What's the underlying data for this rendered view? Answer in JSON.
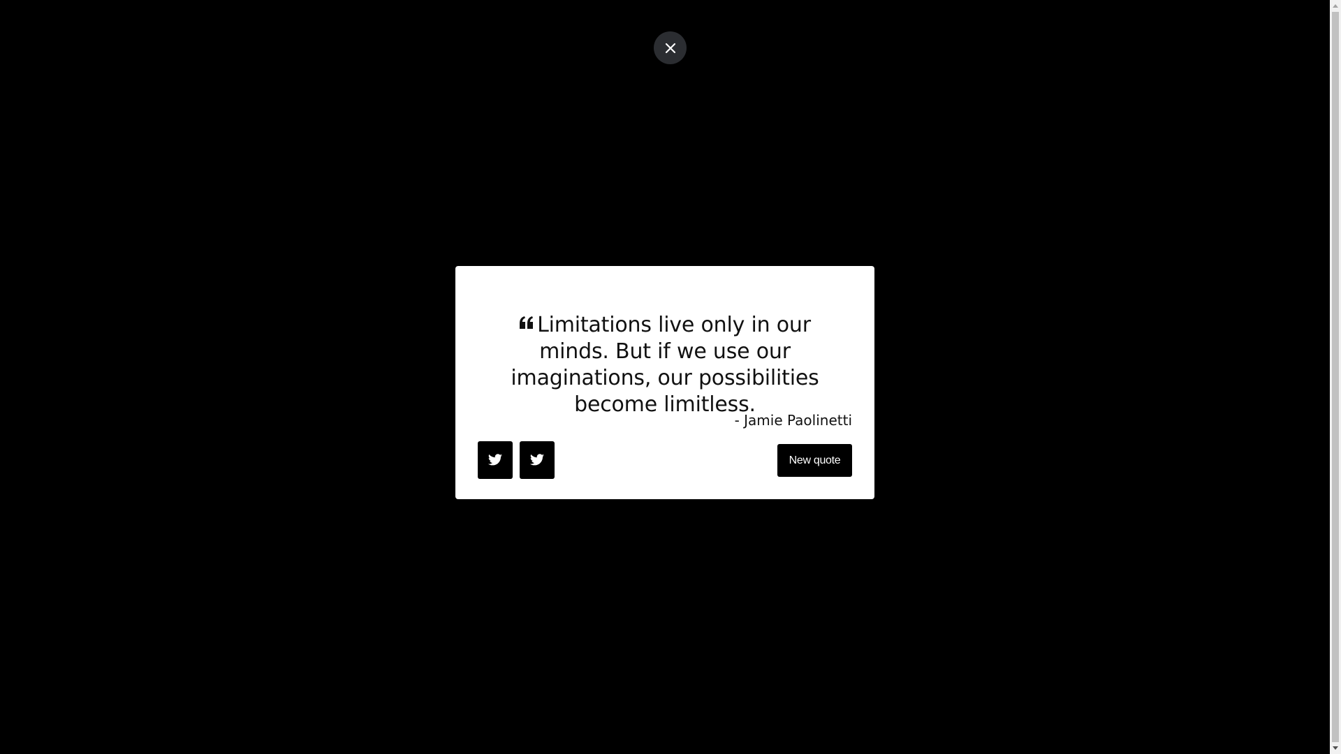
{
  "colors": {
    "background": "#000000",
    "card": "#ffffff",
    "button": "#000000",
    "button_text": "#ffffff",
    "close_button": "#2b2d31",
    "text": "#111111"
  },
  "icons": {
    "close": "close-icon",
    "quote": "quote-left-icon",
    "share_1": "twitter-icon",
    "share_2": "twitter-icon"
  },
  "quote": {
    "text": "Limitations live only in our minds. But if we use our imaginations, our possibilities become limitless.",
    "author": "- Jamie Paolinetti"
  },
  "actions": {
    "new_quote_label": "New quote"
  }
}
